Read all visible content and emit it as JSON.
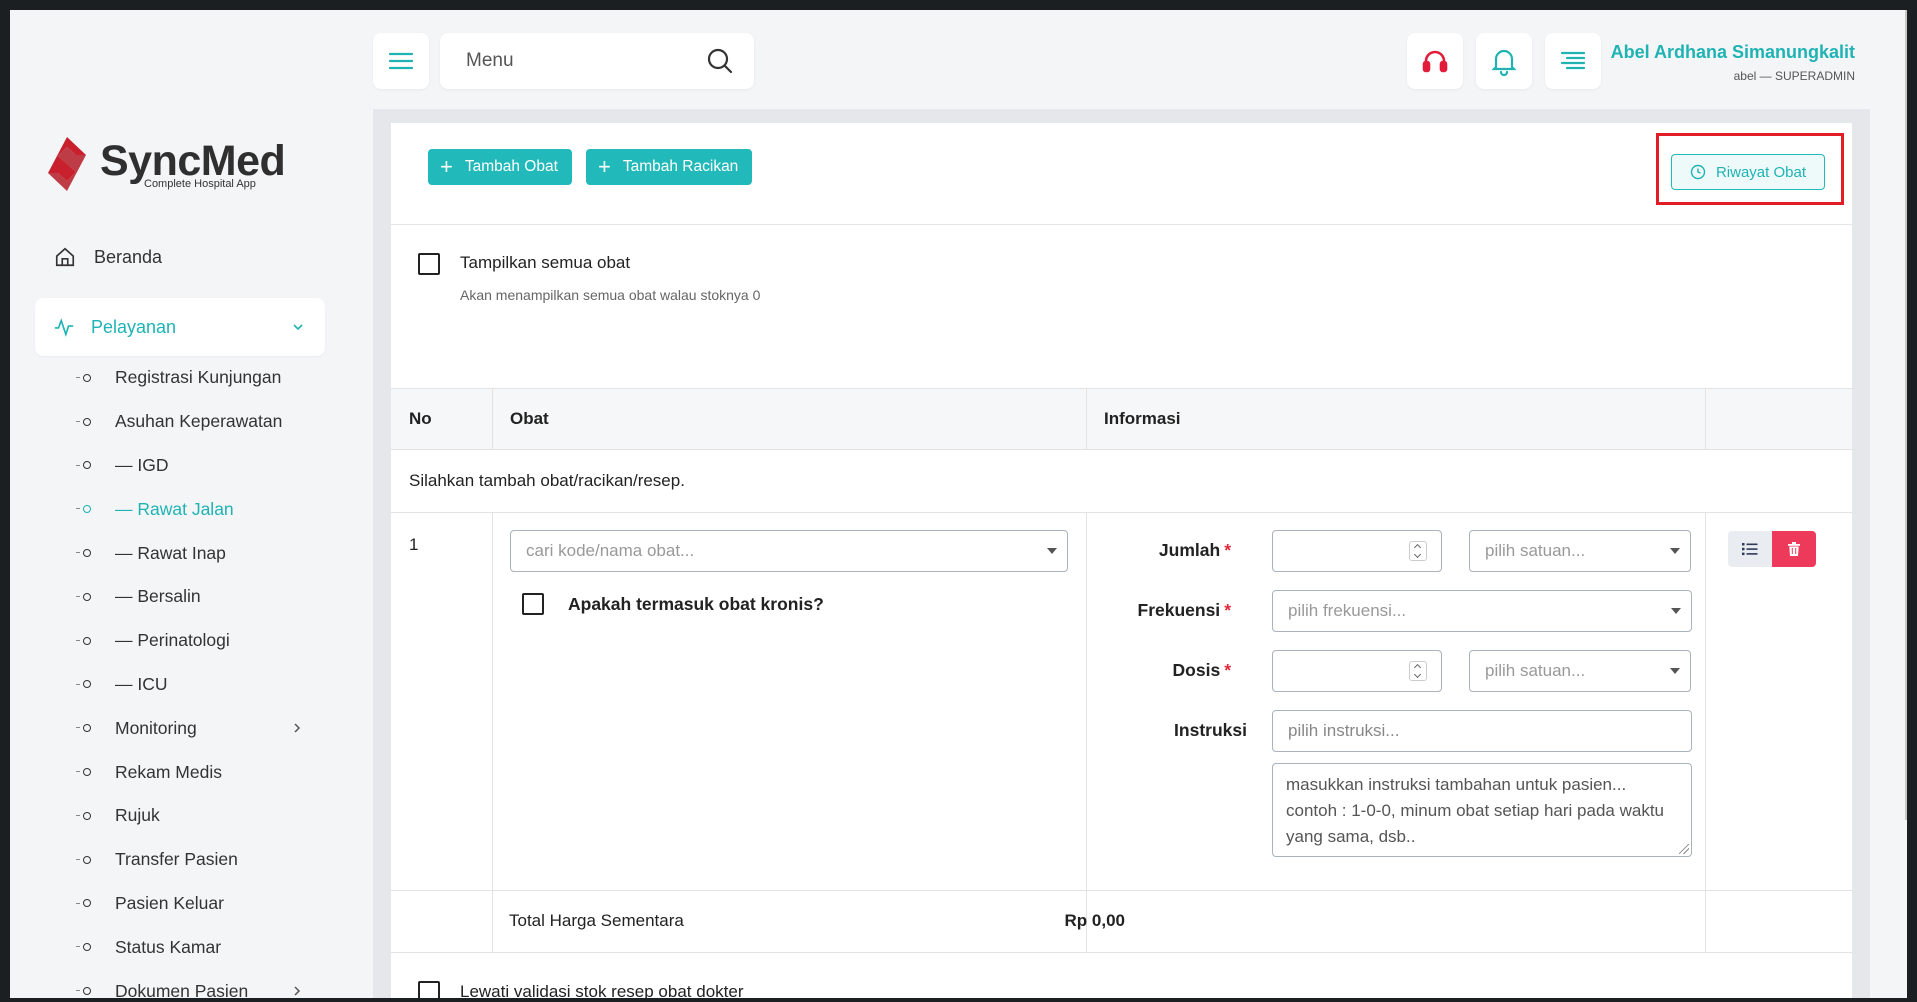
{
  "brand": {
    "name": "SyncMed",
    "tagline": "Complete Hospital App",
    "accent": "#1fb3b4",
    "logo_color": "#c8202d"
  },
  "search": {
    "placeholder": "Menu"
  },
  "user": {
    "name": "Abel Ardhana Simanungkalit",
    "role": "abel — SUPERADMIN"
  },
  "topbar": {
    "icons": [
      "menu-icon",
      "headset-icon",
      "bell-icon",
      "align-right-icon"
    ]
  },
  "sidebar": {
    "home": "Beranda",
    "section": "Pelayanan",
    "items": [
      {
        "label": "Registrasi Kunjungan"
      },
      {
        "label": "Asuhan Keperawatan"
      },
      {
        "label": "— IGD"
      },
      {
        "label": "— Rawat Jalan",
        "active": true
      },
      {
        "label": "— Rawat Inap"
      },
      {
        "label": "— Bersalin"
      },
      {
        "label": "— Perinatologi"
      },
      {
        "label": "— ICU"
      },
      {
        "label": "Monitoring",
        "has_children": true
      },
      {
        "label": "Rekam Medis"
      },
      {
        "label": "Rujuk"
      },
      {
        "label": "Transfer Pasien"
      },
      {
        "label": "Pasien Keluar"
      },
      {
        "label": "Status Kamar"
      },
      {
        "label": "Dokumen Pasien",
        "has_children": true
      }
    ]
  },
  "toolbar": {
    "add_drug": "Tambah Obat",
    "add_compound": "Tambah Racikan",
    "history": "Riwayat Obat"
  },
  "show_all": {
    "label": "Tampilkan semua obat",
    "description": "Akan menampilkan semua obat walau stoknya 0"
  },
  "table": {
    "headers": [
      "No",
      "Obat",
      "Informasi",
      ""
    ],
    "empty_message": "Silahkan tambah obat/racikan/resep.",
    "row": {
      "no": "1",
      "drug_placeholder": "cari kode/nama obat...",
      "chronic_label": "Apakah termasuk obat kronis?",
      "jumlah_label": "Jumlah",
      "frekuensi_label": "Frekuensi",
      "dosis_label": "Dosis",
      "instruksi_label": "Instruksi",
      "unit_placeholder": "pilih satuan...",
      "frequency_placeholder": "pilih frekuensi...",
      "instruction_placeholder": "pilih instruksi...",
      "extra_instruction_placeholder": "masukkan instruksi tambahan untuk pasien... contoh : 1-0-0, minum obat setiap hari pada waktu yang sama, dsb.."
    },
    "total_label": "Total Harga Sementara",
    "total_value": "Rp 0,00"
  },
  "skip_validation": {
    "label": "Lewati validasi stok resep obat dokter"
  }
}
